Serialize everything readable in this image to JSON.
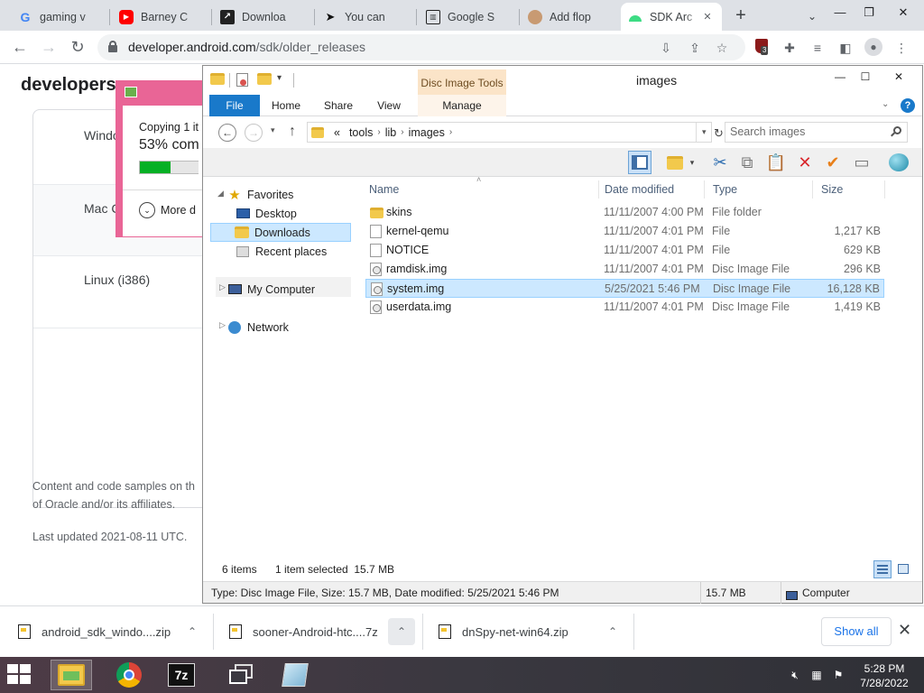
{
  "browser": {
    "tabs": [
      {
        "title": "gaming v",
        "favicon": "google-g",
        "active": false
      },
      {
        "title": "Barney C",
        "favicon": "youtube",
        "active": false
      },
      {
        "title": "Downloa",
        "favicon": "download-arrow",
        "active": false
      },
      {
        "title": "You can",
        "favicon": "bird-logo",
        "active": false
      },
      {
        "title": "Google S",
        "favicon": "building-columns",
        "active": false
      },
      {
        "title": "Add flop",
        "favicon": "person-photo",
        "active": false
      },
      {
        "title": "SDK Arc",
        "favicon": "android",
        "active": true
      }
    ],
    "new_tab_symbol": "+",
    "tab_close_symbol": "✕",
    "url_domain": "developer.android.com",
    "url_path": "/sdk/older_releases",
    "extension_badge": "3"
  },
  "webpage": {
    "logo": "developers",
    "rows": {
      "windows": "Windo",
      "mac": "Mac C",
      "linux": "Linux (i386)"
    },
    "footer_line1": "Content and code samples on th",
    "footer_line2": "of Oracle and/or its affiliates.",
    "last_updated": "Last updated 2021-08-11 UTC."
  },
  "copy_dialog": {
    "line1": "Copying 1 it",
    "line2": "53% com",
    "progress": 0.53,
    "more_details": "More d"
  },
  "explorer": {
    "title": "images",
    "context_tab_group": "Disc Image Tools",
    "ribbon_tabs": [
      "File",
      "Home",
      "Share",
      "View",
      "Manage"
    ],
    "breadcrumb": [
      "tools",
      "lib",
      "images"
    ],
    "breadcrumb_overflow": "«",
    "search_placeholder": "Search images",
    "nav": {
      "favorites": "Favorites",
      "desktop": "Desktop",
      "downloads": "Downloads",
      "recent": "Recent places",
      "my_computer": "My Computer",
      "network": "Network"
    },
    "columns": {
      "name": "Name",
      "date": "Date modified",
      "type": "Type",
      "size": "Size"
    },
    "files": [
      {
        "name": "skins",
        "date": "11/11/2007 4:00 PM",
        "type": "File folder",
        "size": "",
        "icon": "folder-icon"
      },
      {
        "name": "kernel-qemu",
        "date": "11/11/2007 4:01 PM",
        "type": "File",
        "size": "1,217 KB",
        "icon": "file-icon"
      },
      {
        "name": "NOTICE",
        "date": "11/11/2007 4:01 PM",
        "type": "File",
        "size": "629 KB",
        "icon": "file-icon"
      },
      {
        "name": "ramdisk.img",
        "date": "11/11/2007 4:01 PM",
        "type": "Disc Image File",
        "size": "296 KB",
        "icon": "disc-image-icon"
      },
      {
        "name": "system.img",
        "date": "5/25/2021 5:46 PM",
        "type": "Disc Image File",
        "size": "16,128 KB",
        "icon": "disc-image-icon",
        "selected": true
      },
      {
        "name": "userdata.img",
        "date": "11/11/2007 4:01 PM",
        "type": "Disc Image File",
        "size": "1,419 KB",
        "icon": "disc-image-icon"
      }
    ],
    "status": {
      "count": "6 items",
      "selection": "1 item selected  15.7 MB"
    },
    "detail_bar": {
      "info": "Type: Disc Image File, Size: 15.7 MB, Date modified: 5/25/2021 5:46 PM",
      "size": "15.7 MB",
      "location": "Computer"
    }
  },
  "downloads": [
    {
      "name": "android_sdk_windo....zip",
      "icon": "zip-file-icon"
    },
    {
      "name": "sooner-Android-htc....7z",
      "icon": "zip-file-icon"
    },
    {
      "name": "dnSpy-net-win64.zip",
      "icon": "zip-file-icon"
    }
  ],
  "show_all": "Show all",
  "taskbar": {
    "apps": [
      "file-explorer",
      "chrome",
      "7-zip",
      "task-view",
      "notepad"
    ],
    "sevenzip_label": "7z",
    "time": "5:28 PM",
    "date": "7/28/2022"
  },
  "colors": {
    "chrome_tabstrip": "#dee1e6",
    "explorer_file_tab": "#1979ca",
    "context_tab": "#fbe4c8",
    "selection": "#cce8ff",
    "copy_dialog_border": "#e96596",
    "progress_green": "#06b025"
  }
}
